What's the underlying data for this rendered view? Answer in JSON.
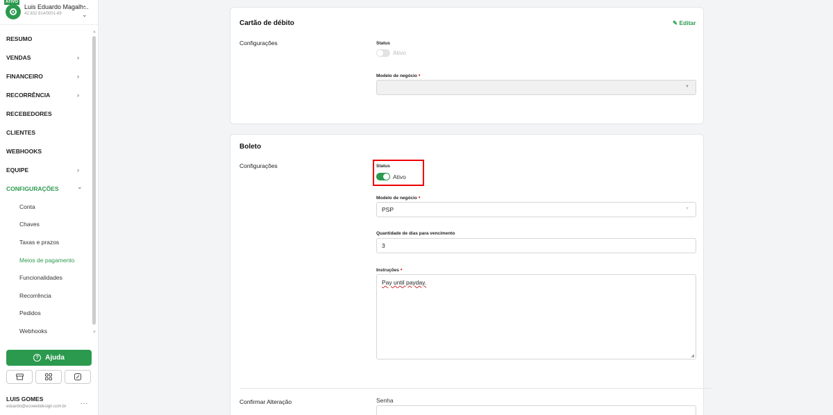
{
  "account": {
    "badge": "ATIVO",
    "name": "Luis Eduardo Magalh...",
    "document": "42.832.914/0001-69"
  },
  "nav": {
    "resumo": "RESUMO",
    "vendas": "VENDAS",
    "financeiro": "FINANCEIRO",
    "recorrencia": "RECORRÊNCIA",
    "recebedores": "RECEBEDORES",
    "clientes": "CLIENTES",
    "webhooks": "WEBHOOKS",
    "equipe": "EQUIPE",
    "configuracoes": "CONFIGURAÇÕES",
    "chevron": "›",
    "chevron_open": "⌄"
  },
  "subnav": {
    "conta": "Conta",
    "chaves": "Chaves",
    "taxas": "Taxas e prazos",
    "meios": "Meios de pagamento",
    "funcionalidades": "Funcionalidades",
    "recorrencia": "Recorrência",
    "pedidos": "Pedidos",
    "webhooks": "Webhooks"
  },
  "help": {
    "label": "Ajuda",
    "icon": "help-circle-icon"
  },
  "tools": {
    "icons": [
      "store-icon",
      "grid-icon",
      "edit-square-icon"
    ]
  },
  "user": {
    "name": "LUIS GOMES",
    "email": "eduardo@ecowebdesign.com.br",
    "more": "..."
  },
  "debit_card": {
    "title": "Cartão de débito",
    "edit_label": "Editar",
    "section_label": "Configurações",
    "status_label": "Status",
    "status_value": "Ativo",
    "status_on": false,
    "model_label": "Modelo de negócio",
    "model_value": ""
  },
  "boleto": {
    "title": "Boleto",
    "section_label": "Configurações",
    "status_label": "Status",
    "status_value": "Ativo",
    "status_on": true,
    "model_label": "Modelo de negócio",
    "model_value": "PSP",
    "days_label": "Quantidade de dias para vencimento",
    "days_value": "3",
    "instructions_label": "Instruções",
    "instructions_value": "Pay until payday."
  },
  "confirm": {
    "label": "Confirmar Alteração",
    "password_label": "Senha"
  },
  "colors": {
    "brand": "#2b9a4e",
    "required": "#d32f2f",
    "highlight": "#ee0000"
  }
}
